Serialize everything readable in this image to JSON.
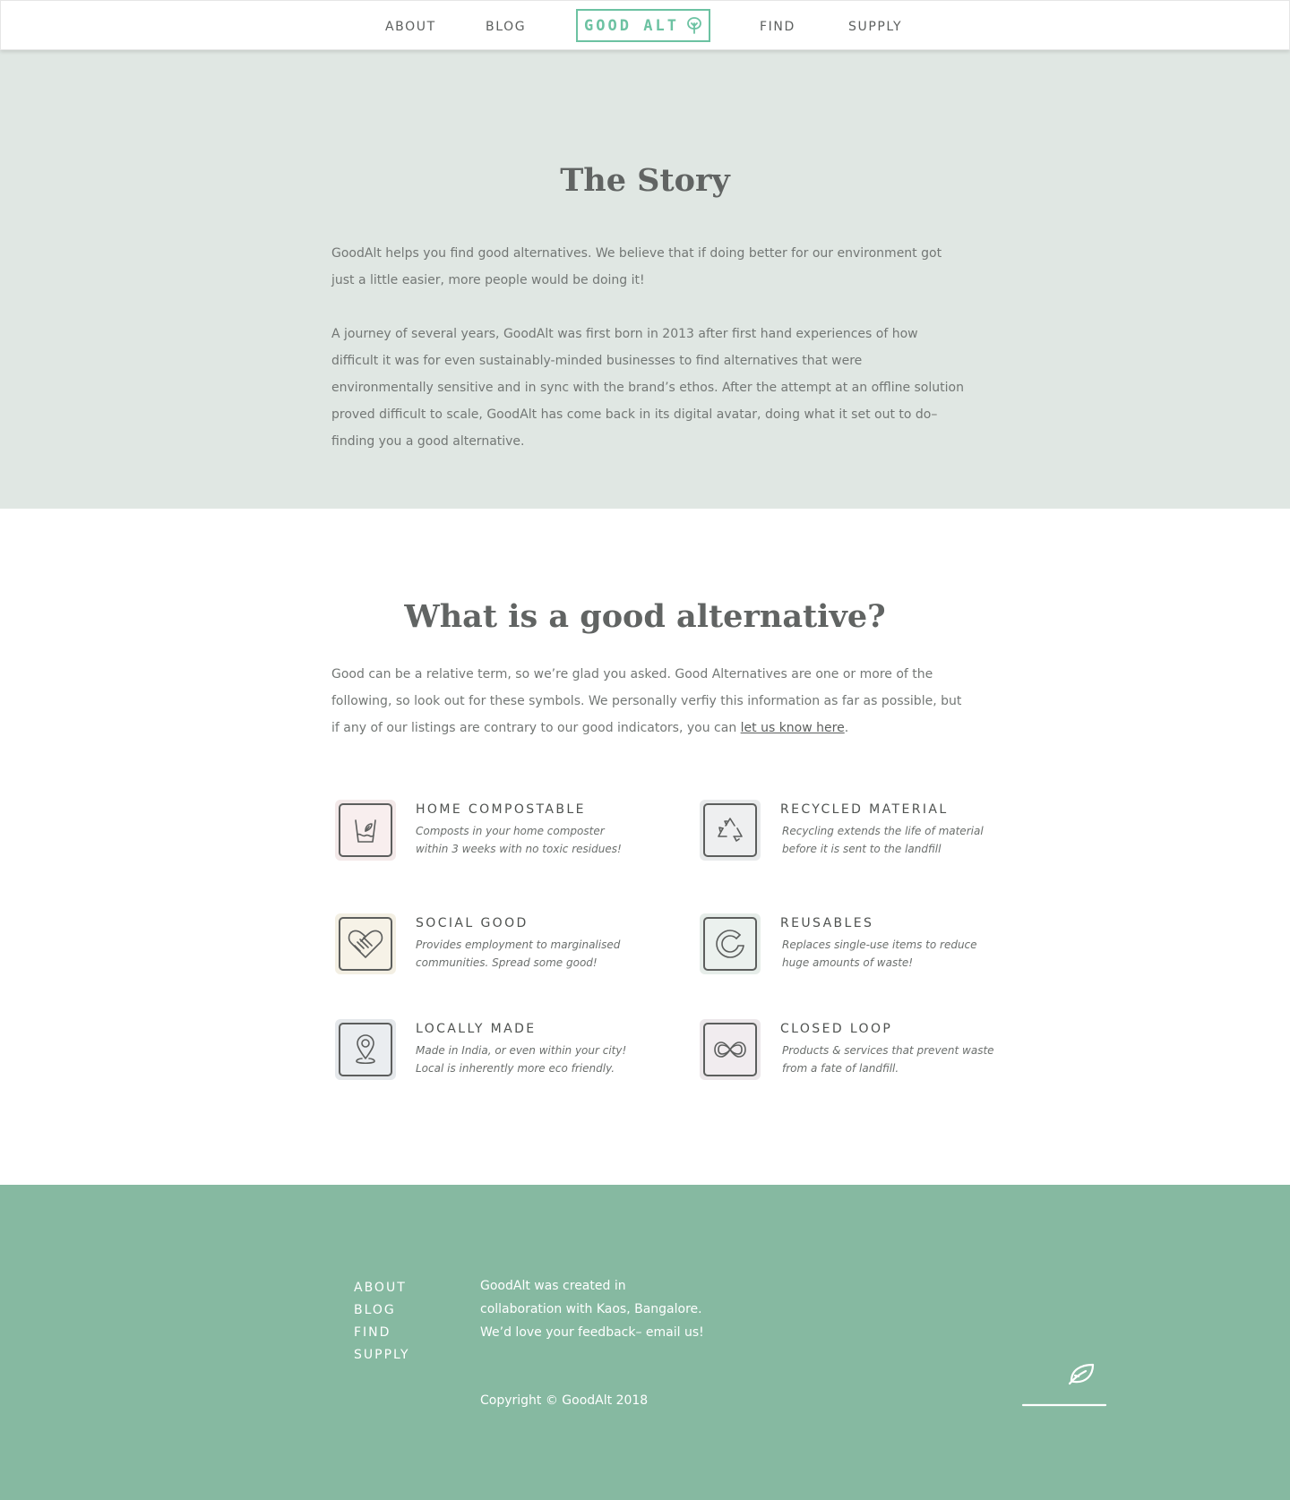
{
  "nav": {
    "about": "ABOUT",
    "blog": "BLOG",
    "logo_text": "GOOD ALT",
    "find": "FIND",
    "supply": "SUPPLY"
  },
  "story": {
    "title": "The Story",
    "p1": "GoodAlt helps you find good alternatives. We believe that if doing better for our environment got just a little easier, more people would be doing it!",
    "p2": "A journey of several years, GoodAlt was first born in 2013 after first hand experiences of how difficult it was for even sustainably-minded businesses to find alternatives that were environmentally sensitive and in sync with the brand’s ethos. After the attempt at an offline solution proved difficult to scale, GoodAlt has come back in its digital avatar, doing what it set out to do– finding you a good alternative."
  },
  "alternative": {
    "title": "What is a good alternative?",
    "intro": "Good can be a relative term, so we’re glad you asked. Good Alternatives are one or more of the following, so look out for these symbols. We personally verfiy this information as far as possible, but if any of our listings are contrary to our good indicators, you can ",
    "link": "let us know here",
    "intro_end": ".",
    "features": [
      {
        "title": "HOME COMPOSTABLE",
        "desc": "Composts in your home composter within 3 weeks with no toxic residues!",
        "icon": "compost-icon"
      },
      {
        "title": "RECYCLED MATERIAL",
        "desc": "Recycling extends the life of material before it is sent to the landfill",
        "icon": "recycle-icon"
      },
      {
        "title": "SOCIAL GOOD",
        "desc": "Provides employment to marginalised communities. Spread some good!",
        "icon": "heart-handshake-icon"
      },
      {
        "title": "REUSABLES",
        "desc": "Replaces single-use items to reduce huge amounts of waste!",
        "icon": "reuse-arrow-icon"
      },
      {
        "title": "LOCALLY MADE",
        "desc": "Made in India, or even within your city! Local is inherently more eco friendly.",
        "icon": "location-pin-icon"
      },
      {
        "title": "CLOSED LOOP",
        "desc": "Products & services that prevent waste from a fate of landfill.",
        "icon": "infinity-icon"
      }
    ]
  },
  "footer": {
    "nav": [
      "ABOUT",
      "BLOG",
      "FIND",
      "SUPPLY"
    ],
    "about": "GoodAlt was created in collaboration with Kaos, Bangalore. We’d love your feedback– email us!",
    "copyright": "Copyright © GoodAlt 2018"
  },
  "colors": {
    "accent": "#6cc2a2",
    "story_bg": "#e0e7e3",
    "footer_bg": "#86b9a1"
  }
}
